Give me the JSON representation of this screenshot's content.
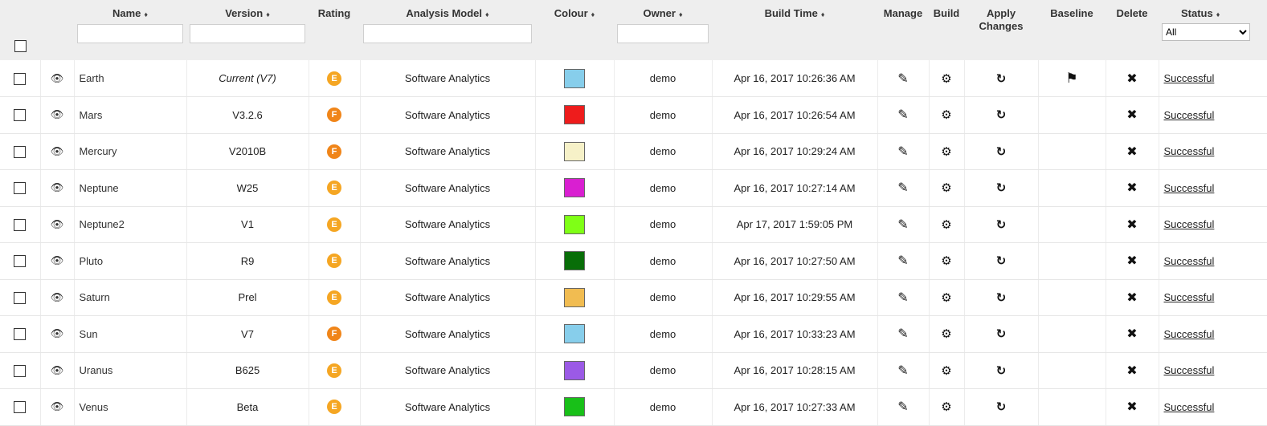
{
  "header": {
    "name": "Name",
    "version": "Version",
    "rating": "Rating",
    "analysis_model": "Analysis Model",
    "colour": "Colour",
    "owner": "Owner",
    "build_time": "Build Time",
    "manage": "Manage",
    "build": "Build",
    "apply_changes": "Apply Changes",
    "baseline": "Baseline",
    "delete": "Delete",
    "status": "Status",
    "sort_glyph": "♦",
    "status_filter_selected": "All"
  },
  "colors": {
    "rating_e": "#f5a623",
    "rating_f": "#f08519",
    "header_bg": "#eeeeee"
  },
  "rows": [
    {
      "name": "Earth",
      "version": "Current (V7)",
      "rating": "E",
      "model": "Software Analytics",
      "colour": "#87ceeb",
      "owner": "demo",
      "build_time": "Apr 16, 2017 10:26:36 AM",
      "baseline": true,
      "status": "Successful"
    },
    {
      "name": "Mars",
      "version": "V3.2.6",
      "rating": "F",
      "model": "Software Analytics",
      "colour": "#ee1c1c",
      "owner": "demo",
      "build_time": "Apr 16, 2017 10:26:54 AM",
      "baseline": false,
      "status": "Successful"
    },
    {
      "name": "Mercury",
      "version": "V2010B",
      "rating": "F",
      "model": "Software Analytics",
      "colour": "#f6f1c8",
      "owner": "demo",
      "build_time": "Apr 16, 2017 10:29:24 AM",
      "baseline": false,
      "status": "Successful"
    },
    {
      "name": "Neptune",
      "version": "W25",
      "rating": "E",
      "model": "Software Analytics",
      "colour": "#d91fd1",
      "owner": "demo",
      "build_time": "Apr 16, 2017 10:27:14 AM",
      "baseline": false,
      "status": "Successful"
    },
    {
      "name": "Neptune2",
      "version": "V1",
      "rating": "E",
      "model": "Software Analytics",
      "colour": "#7fff16",
      "owner": "demo",
      "build_time": "Apr 17, 2017 1:59:05 PM",
      "baseline": false,
      "status": "Successful"
    },
    {
      "name": "Pluto",
      "version": "R9",
      "rating": "E",
      "model": "Software Analytics",
      "colour": "#086e08",
      "owner": "demo",
      "build_time": "Apr 16, 2017 10:27:50 AM",
      "baseline": false,
      "status": "Successful"
    },
    {
      "name": "Saturn",
      "version": "Prel",
      "rating": "E",
      "model": "Software Analytics",
      "colour": "#f1bc51",
      "owner": "demo",
      "build_time": "Apr 16, 2017 10:29:55 AM",
      "baseline": false,
      "status": "Successful"
    },
    {
      "name": "Sun",
      "version": "V7",
      "rating": "F",
      "model": "Software Analytics",
      "colour": "#87ceeb",
      "owner": "demo",
      "build_time": "Apr 16, 2017 10:33:23 AM",
      "baseline": false,
      "status": "Successful"
    },
    {
      "name": "Uranus",
      "version": "B625",
      "rating": "E",
      "model": "Software Analytics",
      "colour": "#9b5ae6",
      "owner": "demo",
      "build_time": "Apr 16, 2017 10:28:15 AM",
      "baseline": false,
      "status": "Successful"
    },
    {
      "name": "Venus",
      "version": "Beta",
      "rating": "E",
      "model": "Software Analytics",
      "colour": "#18c018",
      "owner": "demo",
      "build_time": "Apr 16, 2017 10:27:33 AM",
      "baseline": false,
      "status": "Successful"
    }
  ]
}
